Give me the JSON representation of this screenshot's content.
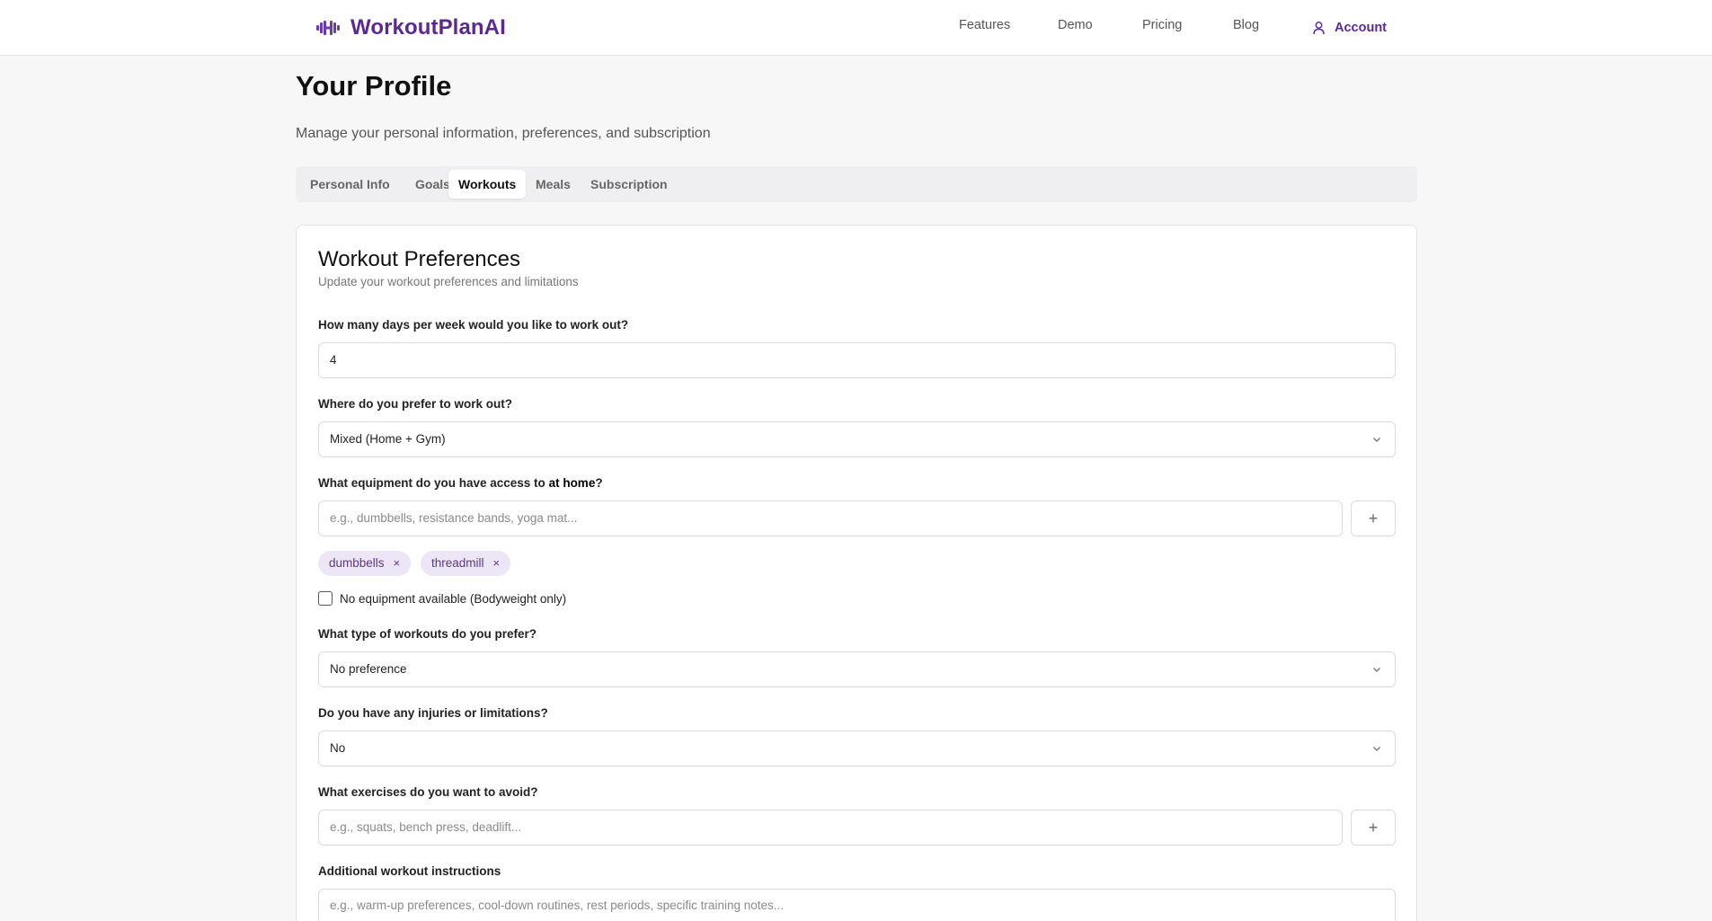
{
  "brand": {
    "name": "WorkoutPlanAI",
    "accent": "#5b2a91"
  },
  "nav": {
    "features": "Features",
    "demo": "Demo",
    "pricing": "Pricing",
    "blog": "Blog",
    "account": "Account"
  },
  "page": {
    "title": "Your Profile",
    "subtitle": "Manage your personal information, preferences, and subscription"
  },
  "tabs": [
    {
      "label": "Personal Info",
      "active": false
    },
    {
      "label": "Goals",
      "active": false
    },
    {
      "label": "Workouts",
      "active": true
    },
    {
      "label": "Meals",
      "active": false
    },
    {
      "label": "Subscription",
      "active": false
    }
  ],
  "card": {
    "title": "Workout Preferences",
    "description": "Update your workout preferences and limitations"
  },
  "form": {
    "days": {
      "label": "How many days per week would you like to work out?",
      "value": "4"
    },
    "location": {
      "label": "Where do you prefer to work out?",
      "value": "Mixed (Home + Gym)"
    },
    "equipment": {
      "label_prefix": "What equipment do you have access to ",
      "label_emphasis": "at home",
      "label_suffix": "?",
      "placeholder": "e.g., dumbbells, resistance bands, yoga mat...",
      "tags": [
        "dumbbells",
        "threadmill"
      ],
      "remove_glyph": "×",
      "add_glyph": "+"
    },
    "no_equipment": {
      "label": "No equipment available (Bodyweight only)",
      "checked": false
    },
    "workout_type": {
      "label": "What type of workouts do you prefer?",
      "value": "No preference"
    },
    "injuries": {
      "label": "Do you have any injuries or limitations?",
      "value": "No"
    },
    "avoid": {
      "label": "What exercises do you want to avoid?",
      "placeholder": "e.g., squats, bench press, deadlift...",
      "add_glyph": "+"
    },
    "instructions": {
      "label": "Additional workout instructions",
      "placeholder": "e.g., warm-up preferences, cool-down routines, rest periods, specific training notes..."
    }
  },
  "icons": {
    "logo": "dumbbell-waveform-icon",
    "account": "user-icon",
    "select": "chevron-down-icon",
    "add": "plus-icon",
    "remove": "close-icon"
  }
}
